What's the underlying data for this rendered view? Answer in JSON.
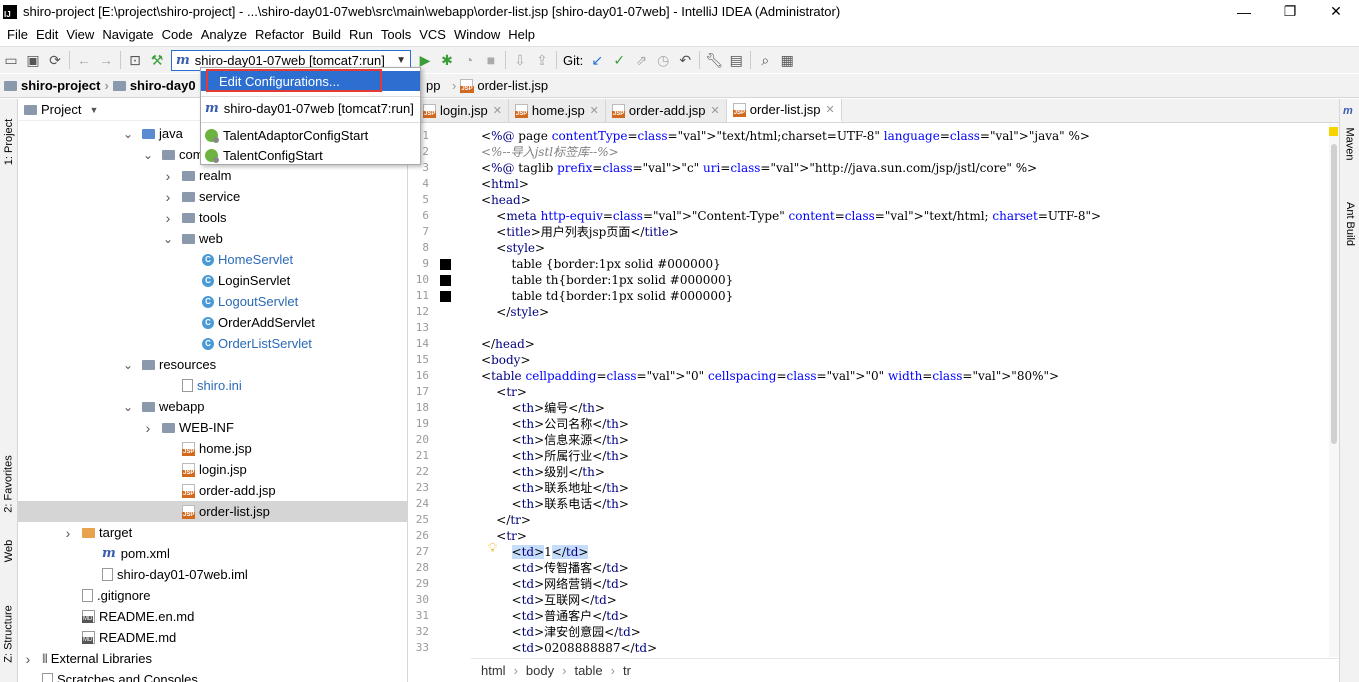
{
  "window": {
    "title": "shiro-project [E:\\project\\shiro-project] - ...\\shiro-day01-07web\\src\\main\\webapp\\order-list.jsp [shiro-day01-07web] - IntelliJ IDEA (Administrator)",
    "app_icon_text": "IJ",
    "minimize": "—",
    "maximize": "❐",
    "close": "✕"
  },
  "menu": [
    "File",
    "Edit",
    "View",
    "Navigate",
    "Code",
    "Analyze",
    "Refactor",
    "Build",
    "Run",
    "Tools",
    "VCS",
    "Window",
    "Help"
  ],
  "toolbar": {
    "run_config": "shiro-day01-07web [tomcat7:run]",
    "git_label": "Git:"
  },
  "popup": {
    "items": [
      "Edit Configurations...",
      "shiro-day01-07web [tomcat7:run]",
      "TalentAdaptorConfigStart",
      "TalentConfigStart"
    ]
  },
  "navbar": {
    "crumb1": "shiro-project",
    "crumb2": "shiro-day0",
    "crumb3_tail": "pp",
    "file": "order-list.jsp"
  },
  "left_stripe": {
    "project": "1: Project",
    "favorites": "2: Favorites",
    "web": "Web",
    "structure": "Z: Structure"
  },
  "right_stripe": {
    "maven": "Maven",
    "ant": "Ant Build"
  },
  "project_panel": {
    "header": "Project",
    "tree": [
      {
        "label": "java",
        "type": "folder-blue",
        "indent": 5,
        "arrow": "down"
      },
      {
        "label": "com.ith",
        "type": "folder",
        "indent": 6,
        "arrow": "down"
      },
      {
        "label": "realm",
        "type": "folder",
        "indent": 7,
        "arrow": "right"
      },
      {
        "label": "service",
        "type": "folder",
        "indent": 7,
        "arrow": "right"
      },
      {
        "label": "tools",
        "type": "folder",
        "indent": 7,
        "arrow": "right"
      },
      {
        "label": "web",
        "type": "folder",
        "indent": 7,
        "arrow": "down"
      },
      {
        "label": "HomeServlet",
        "type": "class",
        "indent": 8,
        "arrow": "",
        "blue": true
      },
      {
        "label": "LoginServlet",
        "type": "class",
        "indent": 8,
        "arrow": "",
        "blue": false
      },
      {
        "label": "LogoutServlet",
        "type": "class",
        "indent": 8,
        "arrow": "",
        "blue": true
      },
      {
        "label": "OrderAddServlet",
        "type": "class",
        "indent": 8,
        "arrow": "",
        "blue": false
      },
      {
        "label": "OrderListServlet",
        "type": "class",
        "indent": 8,
        "arrow": "",
        "blue": true
      },
      {
        "label": "resources",
        "type": "folder",
        "indent": 5,
        "arrow": "down"
      },
      {
        "label": "shiro.ini",
        "type": "file",
        "indent": 7,
        "arrow": "",
        "blue": true
      },
      {
        "label": "webapp",
        "type": "folder",
        "indent": 5,
        "arrow": "down"
      },
      {
        "label": "WEB-INF",
        "type": "folder",
        "indent": 6,
        "arrow": "right"
      },
      {
        "label": "home.jsp",
        "type": "jsp",
        "indent": 7,
        "arrow": ""
      },
      {
        "label": "login.jsp",
        "type": "jsp",
        "indent": 7,
        "arrow": ""
      },
      {
        "label": "order-add.jsp",
        "type": "jsp",
        "indent": 7,
        "arrow": ""
      },
      {
        "label": "order-list.jsp",
        "type": "jsp",
        "indent": 7,
        "arrow": "",
        "selected": true
      },
      {
        "label": "target",
        "type": "folder-orange",
        "indent": 2,
        "arrow": "right"
      },
      {
        "label": "pom.xml",
        "type": "maven",
        "indent": 3,
        "arrow": ""
      },
      {
        "label": "shiro-day01-07web.iml",
        "type": "file",
        "indent": 3,
        "arrow": ""
      },
      {
        "label": ".gitignore",
        "type": "file",
        "indent": 2,
        "arrow": ""
      },
      {
        "label": "README.en.md",
        "type": "md",
        "indent": 2,
        "arrow": ""
      },
      {
        "label": "README.md",
        "type": "md",
        "indent": 2,
        "arrow": ""
      },
      {
        "label": "External Libraries",
        "type": "libs",
        "indent": 0,
        "arrow": "right"
      },
      {
        "label": "Scratches and Consoles",
        "type": "scratch",
        "indent": 0,
        "arrow": ""
      }
    ]
  },
  "editor": {
    "tabs": [
      {
        "label": "login.jsp",
        "active": false
      },
      {
        "label": "home.jsp",
        "active": false
      },
      {
        "label": "order-add.jsp",
        "active": false
      },
      {
        "label": "order-list.jsp",
        "active": true
      }
    ],
    "lines": [
      "<%@ page contentType=\"text/html;charset=UTF-8\" language=\"java\" %>",
      "<%--导入jstl标签库--%>",
      "<%@ taglib prefix=\"c\" uri=\"http://java.sun.com/jsp/jstl/core\" %>",
      "<html>",
      "<head>",
      "    <meta http-equiv=\"Content-Type\" content=\"text/html; charset=UTF-8\">",
      "    <title>用户列表jsp页面</title>",
      "    <style>",
      "        table {border:1px solid #000000}",
      "        table th{border:1px solid #000000}",
      "        table td{border:1px solid #000000}",
      "    </style>",
      "",
      "</head>",
      "<body>",
      "<table cellpadding=\"0\" cellspacing=\"0\" width=\"80%\">",
      "    <tr>",
      "        <th>编号</th>",
      "        <th>公司名称</th>",
      "        <th>信息来源</th>",
      "        <th>所属行业</th>",
      "        <th>级别</th>",
      "        <th>联系地址</th>",
      "        <th>联系电话</th>",
      "    </tr>",
      "    <tr>",
      "        <td>1</td>",
      "        <td>传智播客</td>",
      "        <td>网络营销</td>",
      "        <td>互联网</td>",
      "        <td>普通客户</td>",
      "        <td>津安创意园</td>",
      "        <td>0208888887</td>"
    ],
    "breakpoint_lines": [
      9,
      10,
      11
    ],
    "current_line": 27,
    "footer_crumbs": [
      "html",
      "body",
      "table",
      "tr"
    ]
  }
}
